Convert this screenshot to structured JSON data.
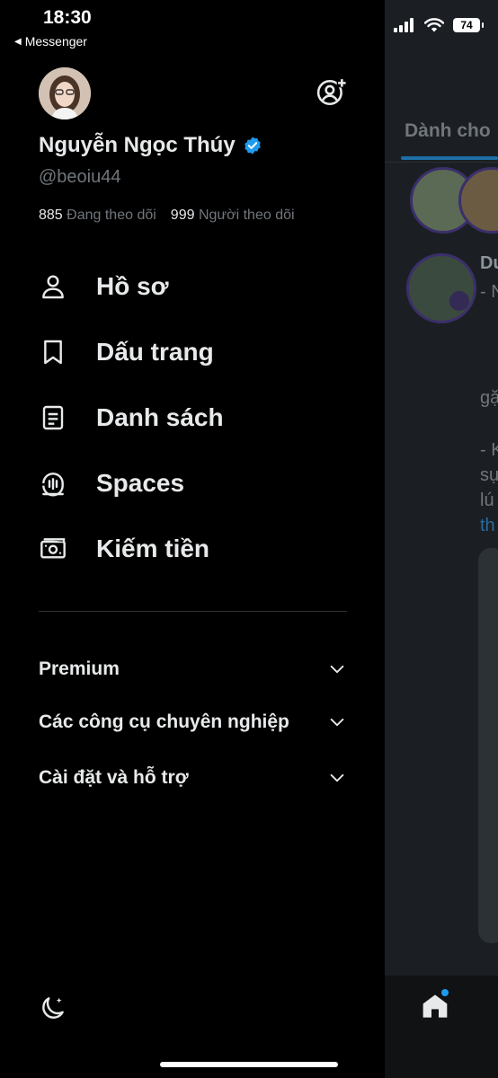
{
  "status_bar": {
    "time": "18:30",
    "back_app": "Messenger",
    "battery": "74"
  },
  "profile": {
    "name": "Nguyễn Ngọc Thúy",
    "handle": "@beoiu44",
    "following_count": "885",
    "following_label": "Đang theo dõi",
    "followers_count": "999",
    "followers_label": "Người theo dõi"
  },
  "menu": {
    "items": [
      {
        "label": "Hồ sơ",
        "icon": "person-icon"
      },
      {
        "label": "Dấu trang",
        "icon": "bookmark-icon"
      },
      {
        "label": "Danh sách",
        "icon": "list-icon"
      },
      {
        "label": "Spaces",
        "icon": "spaces-icon"
      },
      {
        "label": "Kiếm tiền",
        "icon": "money-icon"
      }
    ]
  },
  "sections": {
    "premium": "Premium",
    "pro_tools": "Các công cụ chuyên nghiệp",
    "settings": "Cài đặt và hỗ trợ"
  },
  "background": {
    "tab_label": "Dành cho",
    "post_name": "Du",
    "line1": "- N",
    "line2": "gặ",
    "line3": "- K",
    "line4": "sự",
    "line5": "lú",
    "link": "th"
  },
  "colors": {
    "accent": "#1d9bf0",
    "background": "#000000",
    "text": "#e7e9ea",
    "muted": "#71767b"
  }
}
